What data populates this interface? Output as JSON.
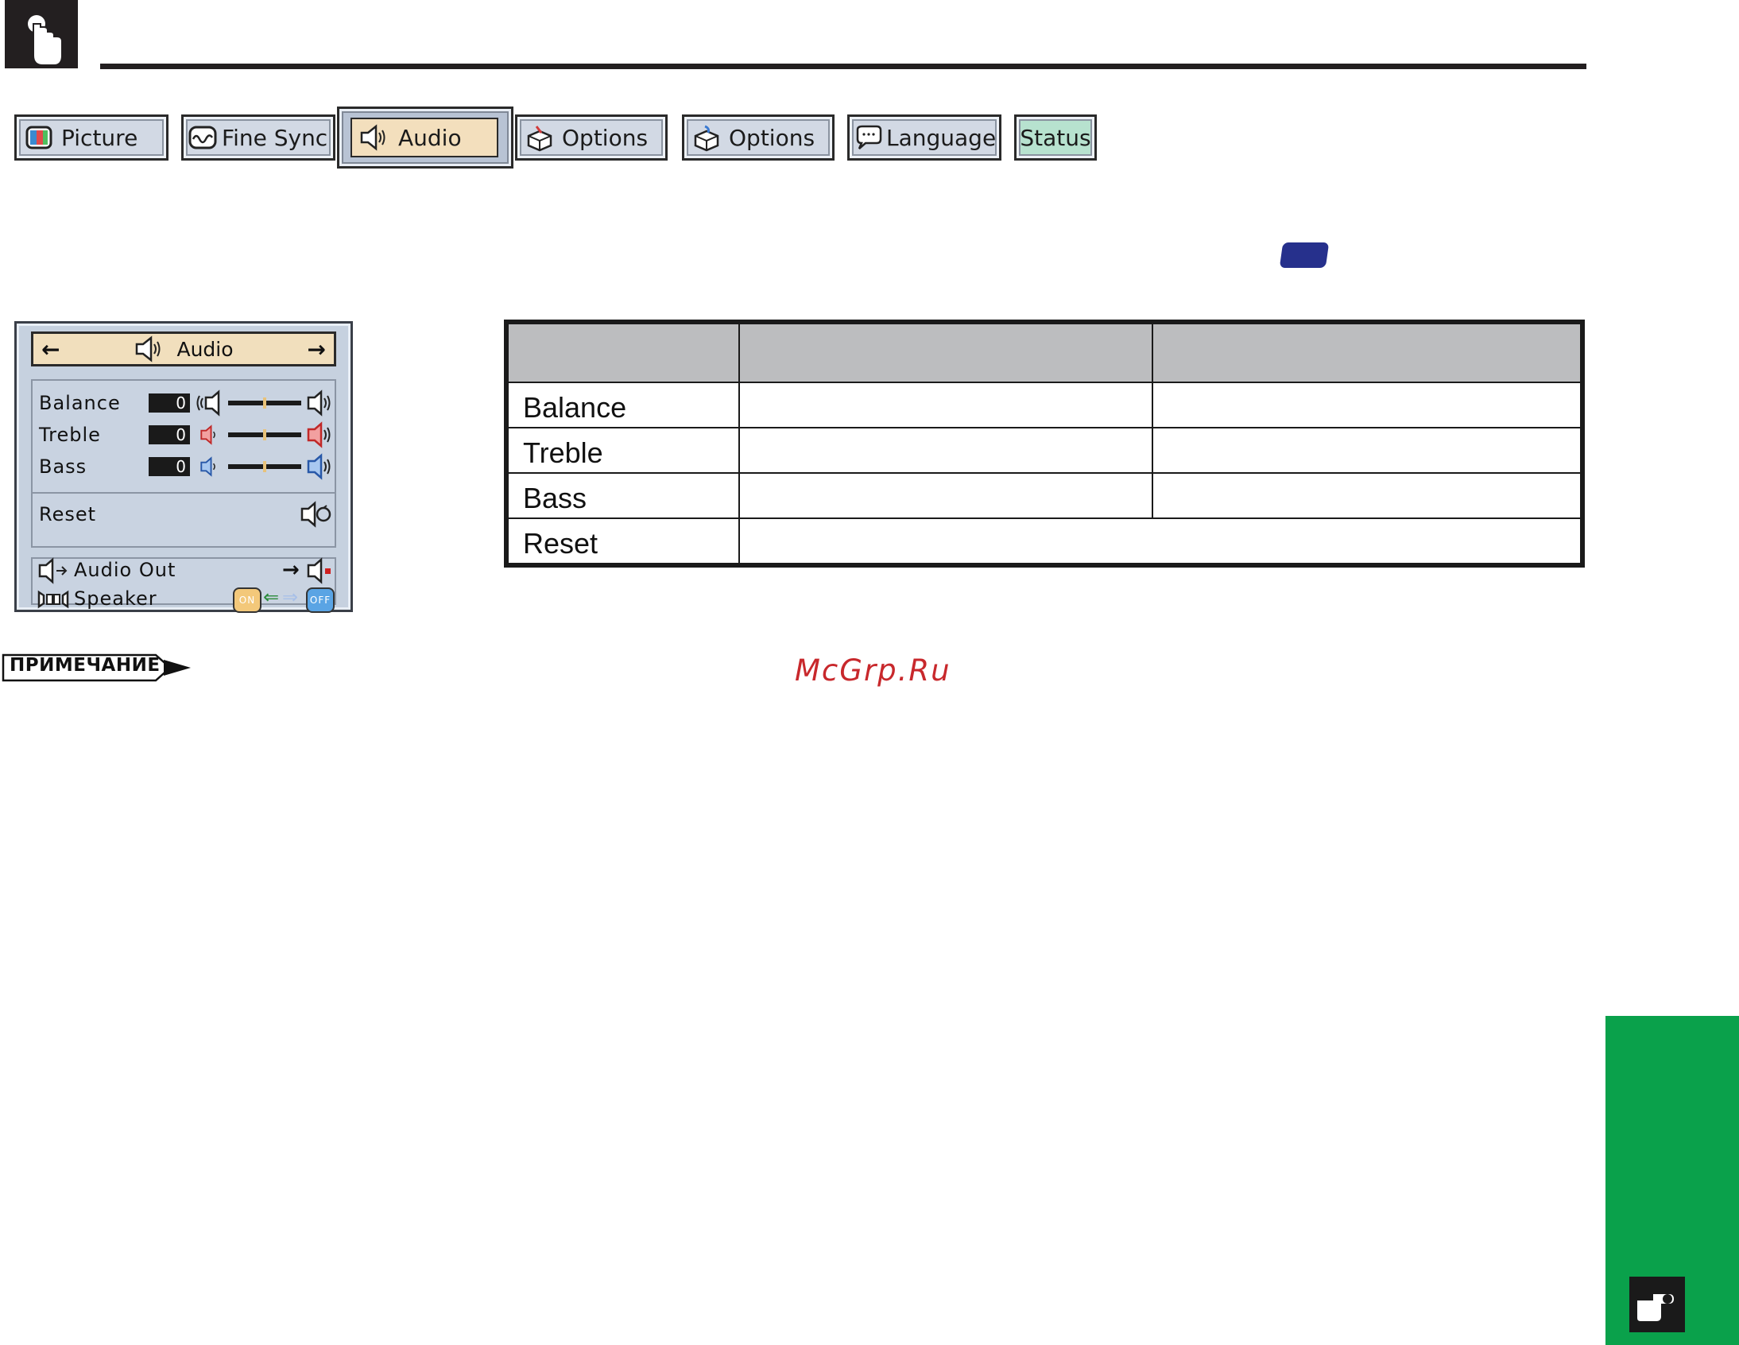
{
  "tabs": [
    {
      "label": "Picture",
      "icon": "monitor-icon"
    },
    {
      "label": "Fine Sync",
      "icon": "waveform-icon"
    },
    {
      "label": "Audio",
      "icon": "speaker-icon",
      "active": true
    },
    {
      "label": "Options",
      "icon": "box-icon"
    },
    {
      "label": "Options",
      "icon": "box-icon"
    },
    {
      "label": "Language",
      "icon": "speech-bubble-icon"
    },
    {
      "label": "Status",
      "icon": ""
    }
  ],
  "osd": {
    "title": "Audio",
    "rows": [
      {
        "label": "Balance",
        "value": "0",
        "slider_level": 0.5
      },
      {
        "label": "Treble",
        "value": "0",
        "slider_level": 0.5
      },
      {
        "label": "Bass",
        "value": "0",
        "slider_level": 0.5
      }
    ],
    "reset_label": "Reset",
    "audio_out_label": "Audio Out",
    "speaker_label": "Speaker",
    "speaker_on": "ON",
    "speaker_off": "OFF"
  },
  "table": {
    "headers": [
      "",
      "",
      ""
    ],
    "rows": [
      [
        "Balance",
        "",
        ""
      ],
      [
        "Treble",
        "",
        ""
      ],
      [
        "Bass",
        "",
        ""
      ],
      [
        "Reset",
        ""
      ]
    ]
  },
  "note_label": "ПРИМЕЧАНИЕ",
  "watermark": "McGrp.Ru",
  "colors": {
    "green_tab": "#0aa14b",
    "blue_pill": "#26308c",
    "tab_active": "#f3dfbd",
    "status_tab": "#b7e2cf"
  }
}
